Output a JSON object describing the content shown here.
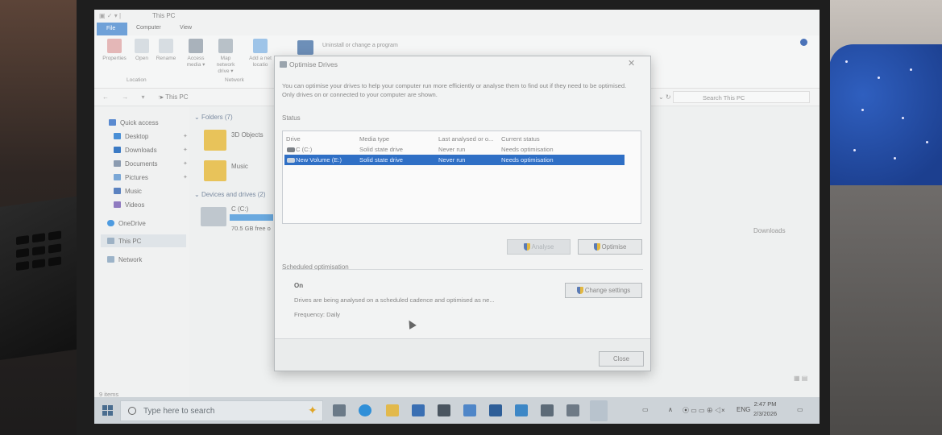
{
  "explorer": {
    "title": "This PC",
    "tabs": {
      "file": "File",
      "computer": "Computer",
      "view": "View"
    },
    "ribbon": {
      "buttons": [
        {
          "label": "Properties",
          "icon": "properties-icon"
        },
        {
          "label": "Open",
          "icon": "open-icon"
        },
        {
          "label": "Rename",
          "icon": "rename-icon"
        },
        {
          "label": "Access media ▾",
          "icon": "access-media-icon"
        },
        {
          "label": "Map network drive ▾",
          "icon": "map-network-drive-icon"
        },
        {
          "label": "Add a net locatio",
          "icon": "add-network-location-icon"
        }
      ],
      "groups": {
        "location": "Location",
        "network": "Network"
      },
      "uninstall": "Uninstall or change a program"
    },
    "address": {
      "path": "This PC",
      "search_placeholder": "Search This PC"
    },
    "nav": {
      "quick_access": "Quick access",
      "items": [
        "Desktop",
        "Downloads",
        "Documents",
        "Pictures",
        "Music",
        "Videos"
      ],
      "onedrive": "OneDrive",
      "this_pc": "This PC",
      "network": "Network"
    },
    "content": {
      "folders_header": "Folders (7)",
      "folders": [
        "3D Objects",
        "Music"
      ],
      "downloads": "Downloads",
      "devices_header": "Devices and drives (2)",
      "drive_label": "C (C:)",
      "drive_free": "70.5 GB free o"
    },
    "status_bar": "9 items"
  },
  "dialog": {
    "title": "Optimise Drives",
    "description": "You can optimise your drives to help your computer run more efficiently or analyse them to find out if they need to be optimised. Only drives on or connected to your computer are shown.",
    "status_label": "Status",
    "columns": [
      "Drive",
      "Media type",
      "Last analysed or o...",
      "Current status"
    ],
    "rows": [
      {
        "drive": "C (C:)",
        "media": "Solid state drive",
        "last": "Never run",
        "status": "Needs optimisation",
        "selected": false
      },
      {
        "drive": "New Volume (E:)",
        "media": "Solid state drive",
        "last": "Never run",
        "status": "Needs optimisation",
        "selected": true
      }
    ],
    "analyse_button": "Analyse",
    "optimise_button": "Optimise",
    "scheduled_label": "Scheduled optimisation",
    "change_settings_button": "Change settings",
    "schedule_state": "On",
    "schedule_description": "Drives are being analysed on a scheduled cadence and optimised as ne...",
    "frequency": "Frequency: Daily",
    "close_button": "Close",
    "selection_color": "#2f6fc5"
  },
  "taskbar": {
    "search_placeholder": "Type here to search",
    "language": "ENG",
    "time": "2:47 PM",
    "date": "2/3/2026"
  }
}
